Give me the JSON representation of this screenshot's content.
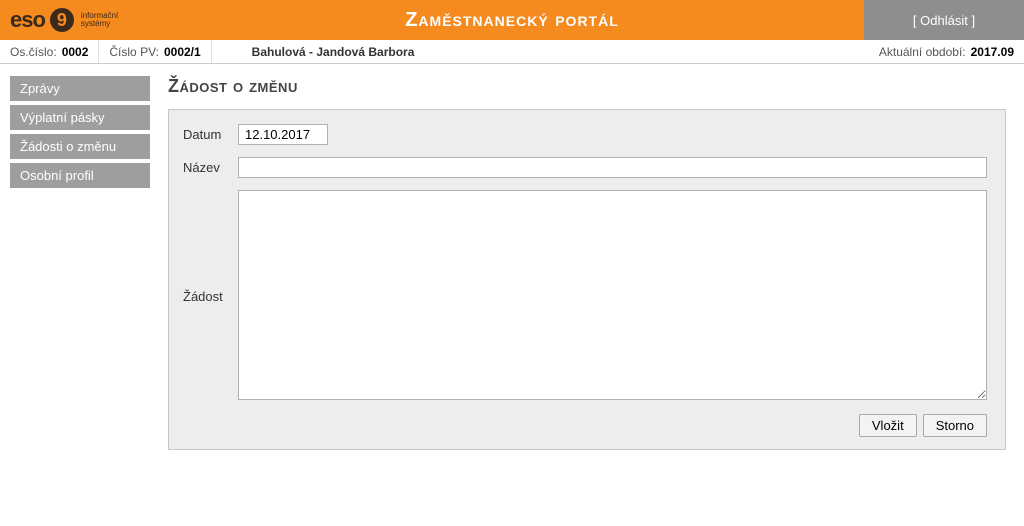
{
  "header": {
    "logo_text": "eso",
    "logo_num": "9",
    "logo_caption_line1": "informační",
    "logo_caption_line2": "systémy",
    "title": "Zaměstnanecký portál",
    "logout": "[ Odhlásit ]"
  },
  "infobar": {
    "osnum_label": "Os.číslo:",
    "osnum_value": "0002",
    "pv_label": "Číslo PV:",
    "pv_value": "0002/1",
    "person_name": "Bahulová - Jandová Barbora",
    "period_label": "Aktuální období:",
    "period_value": "2017.09"
  },
  "sidebar": {
    "items": [
      {
        "label": "Zprávy"
      },
      {
        "label": "Výplatní pásky"
      },
      {
        "label": "Žádosti o změnu"
      },
      {
        "label": "Osobní profil"
      }
    ]
  },
  "page": {
    "title": "Žádost o změnu",
    "form": {
      "date_label": "Datum",
      "date_value": "12.10.2017",
      "name_label": "Název",
      "name_value": "",
      "request_label": "Žádost",
      "request_value": ""
    },
    "buttons": {
      "submit": "Vložit",
      "cancel": "Storno"
    }
  }
}
